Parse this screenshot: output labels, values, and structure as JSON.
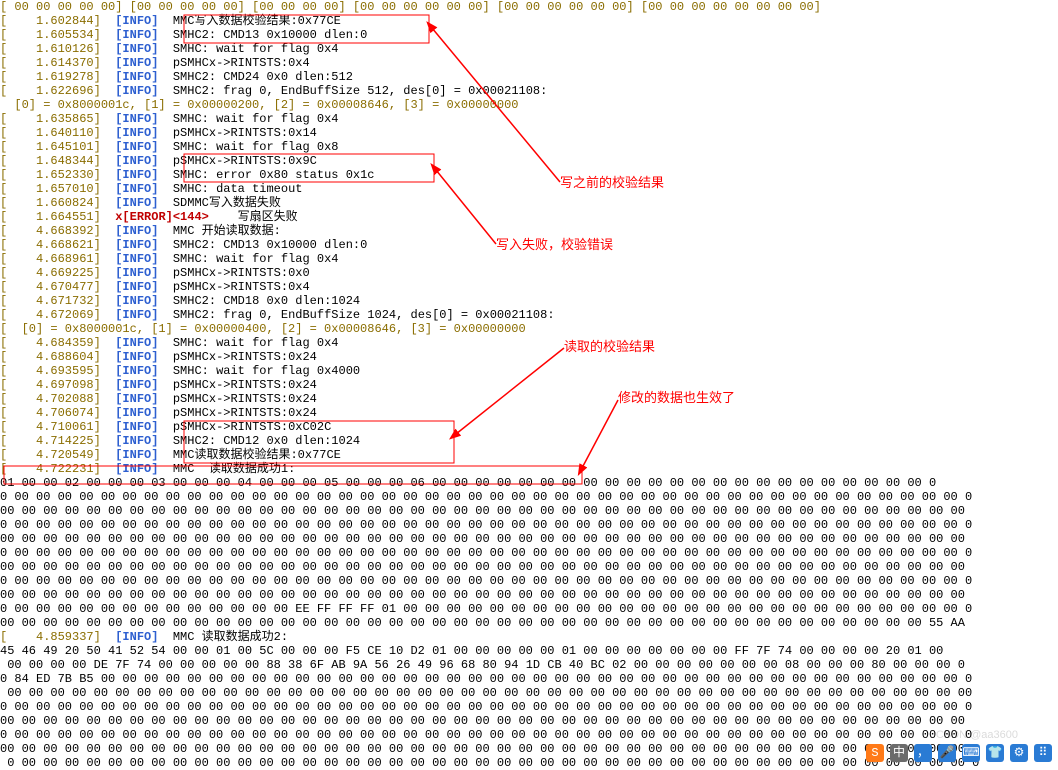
{
  "top_hex": "[ 00 00 00 00 00] [00 00 00 00 00] [00 00 00 00] [00 00 00 00 00 00] [00 00 00 00 00 00] [00 00 00 00 00 00 00 00]",
  "log": [
    {
      "ts": "[    1.602844]",
      "lvl": "[INFO]",
      "msg": "MMC写入数据校验结果:0x77CE"
    },
    {
      "ts": "[    1.605534]",
      "lvl": "[INFO]",
      "msg": "SMHC2: CMD13 0x10000 dlen:0"
    },
    {
      "ts": "[    1.610126]",
      "lvl": "[INFO]",
      "msg": "SMHC: wait for flag 0x4"
    },
    {
      "ts": "[    1.614370]",
      "lvl": "[INFO]",
      "msg": "pSMHCx->RINTSTS:0x4"
    },
    {
      "ts": "[    1.619278]",
      "lvl": "[INFO]",
      "msg": "SMHC2: CMD24 0x0 dlen:512"
    },
    {
      "ts": "[    1.622696]",
      "lvl": "[INFO]",
      "msg": "SMHC2: frag 0, EndBuffSize 512, des[0] = 0x00021108:"
    },
    {
      "ts": "  [0] = 0x8000001c, [1] = 0x00000200, [2] = 0x00008646, [3] = 0x00000000",
      "lvl": "",
      "msg": ""
    },
    {
      "ts": "[    1.635865]",
      "lvl": "[INFO]",
      "msg": "SMHC: wait for flag 0x4"
    },
    {
      "ts": "[    1.640110]",
      "lvl": "[INFO]",
      "msg": "pSMHCx->RINTSTS:0x14"
    },
    {
      "ts": "[    1.645101]",
      "lvl": "[INFO]",
      "msg": "SMHC: wait for flag 0x8"
    },
    {
      "ts": "[    1.648344]",
      "lvl": "[INFO]",
      "msg": "pSMHCx->RINTSTS:0x9C"
    },
    {
      "ts": "[    1.652330]",
      "lvl": "[INFO]",
      "msg": "SMHC: error 0x80 status 0x1c"
    },
    {
      "ts": "[    1.657010]",
      "lvl": "[INFO]",
      "msg": "SMHC: data timeout"
    },
    {
      "ts": "[    1.660824]",
      "lvl": "[INFO]",
      "msg": "SDMMC写入数据失败"
    },
    {
      "ts": "[    1.664551]",
      "lvl": "x[ERROR]<144>",
      "msg": "  写扇区失败"
    },
    {
      "ts": "[    4.668392]",
      "lvl": "[INFO]",
      "msg": "MMC 开始读取数据:"
    },
    {
      "ts": "[    4.668621]",
      "lvl": "[INFO]",
      "msg": "SMHC2: CMD13 0x10000 dlen:0"
    },
    {
      "ts": "[    4.668961]",
      "lvl": "[INFO]",
      "msg": "SMHC: wait for flag 0x4"
    },
    {
      "ts": "[    4.669225]",
      "lvl": "[INFO]",
      "msg": "pSMHCx->RINTSTS:0x0"
    },
    {
      "ts": "[    4.670477]",
      "lvl": "[INFO]",
      "msg": "pSMHCx->RINTSTS:0x4"
    },
    {
      "ts": "[    4.671732]",
      "lvl": "[INFO]",
      "msg": "SMHC2: CMD18 0x0 dlen:1024"
    },
    {
      "ts": "[    4.672069]",
      "lvl": "[INFO]",
      "msg": "SMHC2: frag 0, EndBuffSize 1024, des[0] = 0x00021108:"
    },
    {
      "ts": "[  [0] = 0x8000001c, [1] = 0x00000400, [2] = 0x00008646, [3] = 0x00000000",
      "lvl": "",
      "msg": ""
    },
    {
      "ts": "[    4.684359]",
      "lvl": "[INFO]",
      "msg": "SMHC: wait for flag 0x4"
    },
    {
      "ts": "[    4.688604]",
      "lvl": "[INFO]",
      "msg": "pSMHCx->RINTSTS:0x24"
    },
    {
      "ts": "[    4.693595]",
      "lvl": "[INFO]",
      "msg": "SMHC: wait for flag 0x4000"
    },
    {
      "ts": "[    4.697098]",
      "lvl": "[INFO]",
      "msg": "pSMHCx->RINTSTS:0x24"
    },
    {
      "ts": "[    4.702088]",
      "lvl": "[INFO]",
      "msg": "pSMHCx->RINTSTS:0x24"
    },
    {
      "ts": "[    4.706074]",
      "lvl": "[INFO]",
      "msg": "pSMHCx->RINTSTS:0x24"
    },
    {
      "ts": "[    4.710061]",
      "lvl": "[INFO]",
      "msg": "pSMHCx->RINTSTS:0xC02C"
    },
    {
      "ts": "[    4.714225]",
      "lvl": "[INFO]",
      "msg": "SMHC2: CMD12 0x0 dlen:1024"
    },
    {
      "ts": "[    4.720549]",
      "lvl": "[INFO]",
      "msg": "MMC读取数据校验结果:0x77CE"
    },
    {
      "ts": "[    4.722231]",
      "lvl": "[INFO]",
      "msg": "MMC  读取数据成功1:"
    }
  ],
  "mid_log": {
    "ts": "[    4.859337]",
    "lvl": "[INFO]",
    "msg": "MMC 读取数据成功2:"
  },
  "hex1": "01 00 00 02 00 00 00 03 00 00 00 04 00 00 00 05 00 00 00 06 00 00 00 00 00 00 00 00 00 00 00 00 00 00 00 00 00 00 00 00 00 00 00 0\n0 00 00 00 00 00 00 00 00 00 00 00 00 00 00 00 00 00 00 00 00 00 00 00 00 00 00 00 00 00 00 00 00 00 00 00 00 00 00 00 00 00 00 00 00 0\n00 00 00 00 00 00 00 00 00 00 00 00 00 00 00 00 00 00 00 00 00 00 00 00 00 00 00 00 00 00 00 00 00 00 00 00 00 00 00 00 00 00 00 00 00\n0 00 00 00 00 00 00 00 00 00 00 00 00 00 00 00 00 00 00 00 00 00 00 00 00 00 00 00 00 00 00 00 00 00 00 00 00 00 00 00 00 00 00 00 00 0\n00 00 00 00 00 00 00 00 00 00 00 00 00 00 00 00 00 00 00 00 00 00 00 00 00 00 00 00 00 00 00 00 00 00 00 00 00 00 00 00 00 00 00 00 00\n0 00 00 00 00 00 00 00 00 00 00 00 00 00 00 00 00 00 00 00 00 00 00 00 00 00 00 00 00 00 00 00 00 00 00 00 00 00 00 00 00 00 00 00 00 0\n00 00 00 00 00 00 00 00 00 00 00 00 00 00 00 00 00 00 00 00 00 00 00 00 00 00 00 00 00 00 00 00 00 00 00 00 00 00 00 00 00 00 00 00 00\n0 00 00 00 00 00 00 00 00 00 00 00 00 00 00 00 00 00 00 00 00 00 00 00 00 00 00 00 00 00 00 00 00 00 00 00 00 00 00 00 00 00 00 00 00 0\n00 00 00 00 00 00 00 00 00 00 00 00 00 00 00 00 00 00 00 00 00 00 00 00 00 00 00 00 00 00 00 00 00 00 00 00 00 00 00 00 00 00 00 00 00\n0 00 00 00 00 00 00 00 00 00 00 00 00 00 EE FF FF FF 01 00 00 00 00 00 00 00 00 00 00 00 00 00 00 00 00 00 00 00 00 00 00 00 00 00 00 0\n00 00 00 00 00 00 00 00 00 00 00 00 00 00 00 00 00 00 00 00 00 00 00 00 00 00 00 00 00 00 00 00 00 00 00 00 00 00 00 00 00 00 00 55 AA",
  "hex2": "45 46 49 20 50 41 52 54 00 00 01 00 5C 00 00 00 F5 CE 10 D2 01 00 00 00 00 00 01 00 00 00 00 00 00 00 FF 7F 74 00 00 00 00 20 01 00\n 00 00 00 00 DE 7F 74 00 00 00 00 00 88 38 6F AB 9A 56 26 49 96 68 80 94 1D CB 40 BC 02 00 00 00 00 00 00 00 08 00 00 00 80 00 00 00 0\n0 84 ED 7B B5 00 00 00 00 00 00 00 00 00 00 00 00 00 00 00 00 00 00 00 00 00 00 00 00 00 00 00 00 00 00 00 00 00 00 00 00 00 00 00 00 0\n 00 00 00 00 00 00 00 00 00 00 00 00 00 00 00 00 00 00 00 00 00 00 00 00 00 00 00 00 00 00 00 00 00 00 00 00 00 00 00 00 00 00 00 00 00\n0 00 00 00 00 00 00 00 00 00 00 00 00 00 00 00 00 00 00 00 00 00 00 00 00 00 00 00 00 00 00 00 00 00 00 00 00 00 00 00 00 00 00 00 00 0\n00 00 00 00 00 00 00 00 00 00 00 00 00 00 00 00 00 00 00 00 00 00 00 00 00 00 00 00 00 00 00 00 00 00 00 00 00 00 00 00 00 00 00 00 00\n0 00 00 00 00 00 00 00 00 00 00 00 00 00 00 00 00 00 00 00 00 00 00 00 00 00 00 00 00 00 00 00 00 00 00 00 00 00 00 00 00 00 00 00 00 0\n00 00 00 00 00 00 00 00 00 00 00 00 00 00 00 00 00 00 00 00 00 00 00 00 00 00 00 00 00 00 00 00 00 00 00 00 00 00 00 00 00 00 00 00 00\n 0 00 00 00 00 00 00 00 00 00 00 00 00 00 00 00 00 00 00 00 00 00 00 00 00 00 00 00 00 00 00 00 00 00 00 00 00 00 00 00 00 00 00 00 00 0",
  "annotations": {
    "a1": "写之前的校验结果",
    "a2": "写入失败，校验错误",
    "a3": "读取的校验结果",
    "a4": "修改的数据也生效了"
  },
  "watermark": "CSDN @aa3600",
  "tray": {
    "ime": "中",
    "mic": "🎤",
    "kb": "⌨",
    "person": "👕",
    "gear": "⚙",
    "grid": "⠿"
  }
}
